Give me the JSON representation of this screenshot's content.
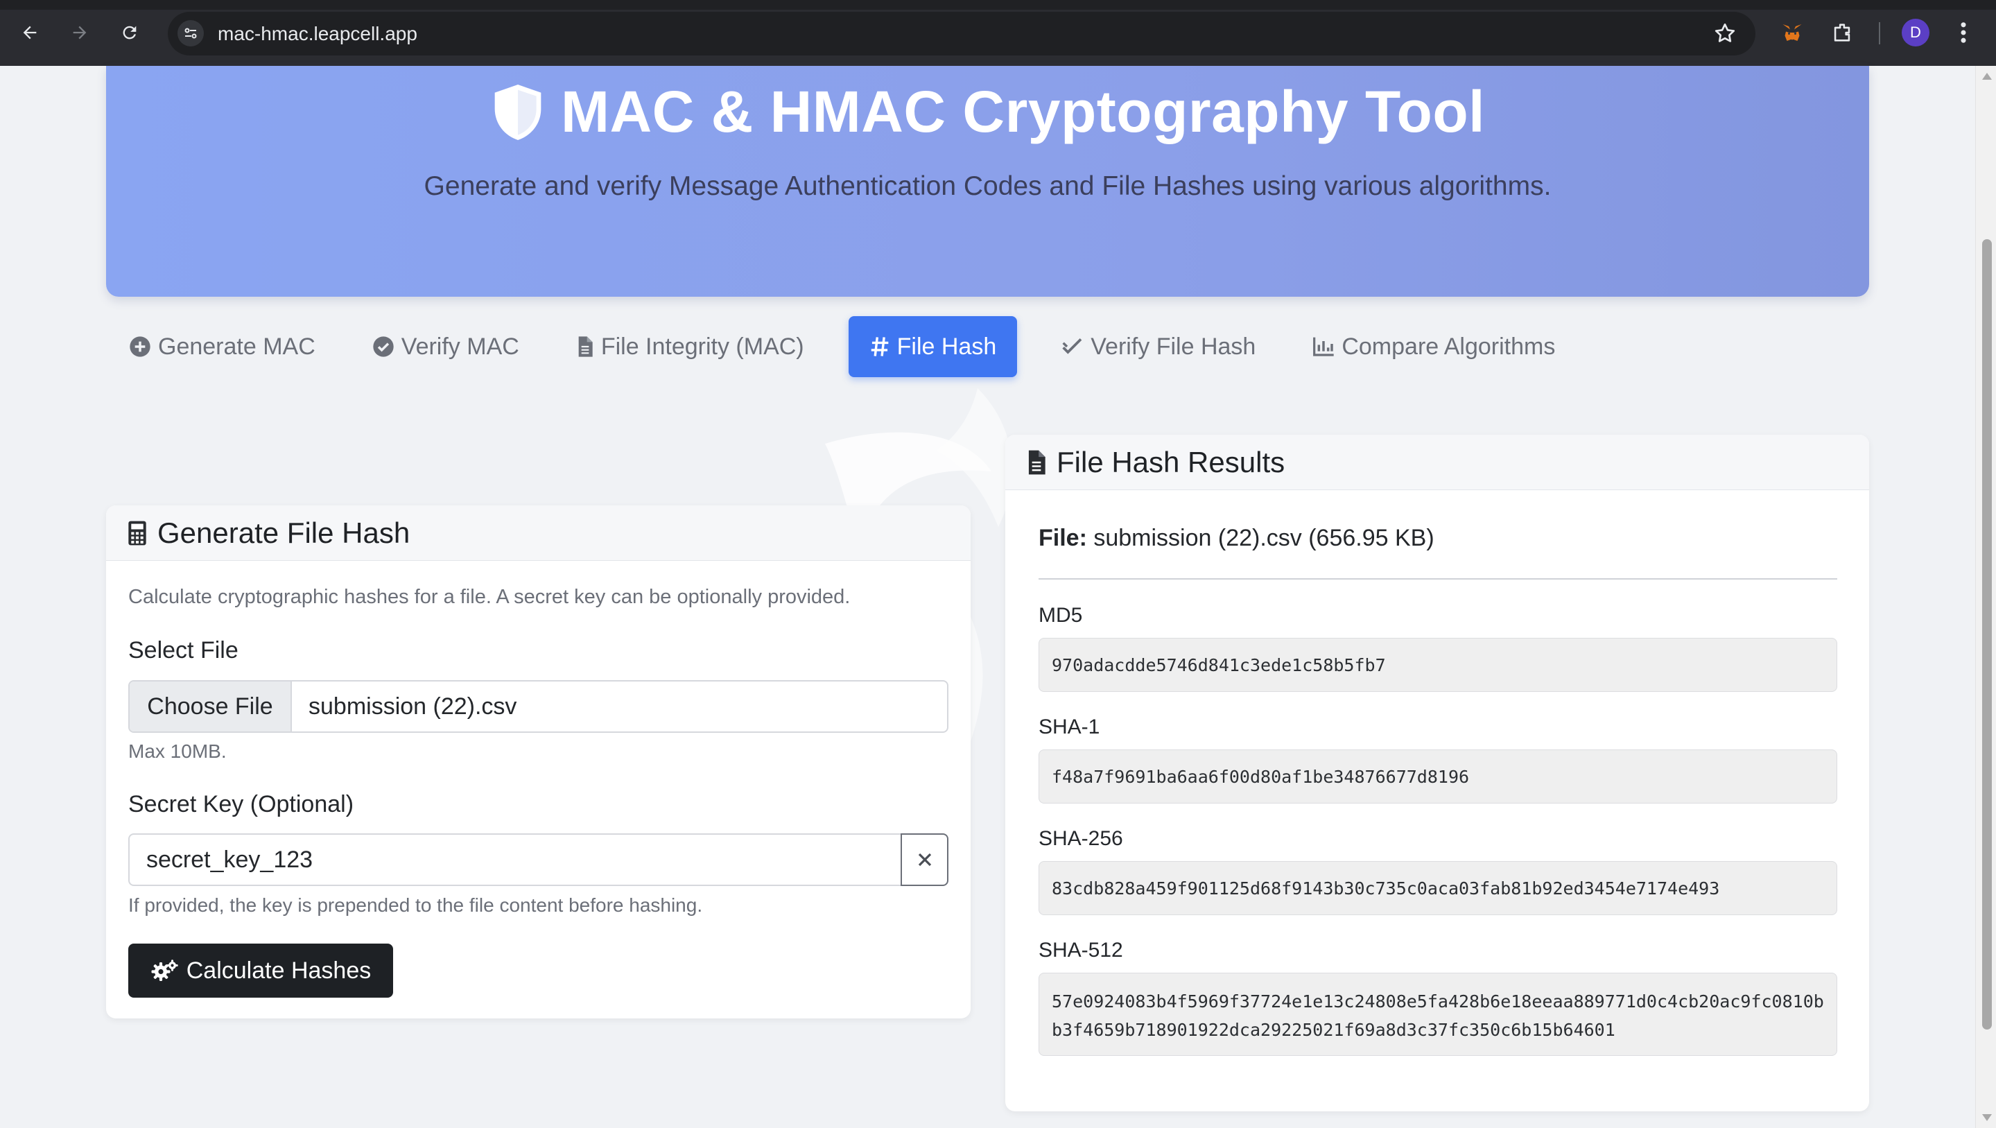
{
  "browser": {
    "url": "mac-hmac.leapcell.app",
    "profile_initial": "D"
  },
  "hero": {
    "title": "MAC & HMAC Cryptography Tool",
    "subtitle": "Generate and verify Message Authentication Codes and File Hashes using various algorithms."
  },
  "tabs": [
    {
      "label": "Generate MAC",
      "icon": "plus-circle-icon",
      "active": false
    },
    {
      "label": "Verify MAC",
      "icon": "check-circle-icon",
      "active": false
    },
    {
      "label": "File Integrity (MAC)",
      "icon": "file-icon",
      "active": false
    },
    {
      "label": "File Hash",
      "icon": "hash-icon",
      "active": true
    },
    {
      "label": "Verify File Hash",
      "icon": "double-check-icon",
      "active": false
    },
    {
      "label": "Compare Algorithms",
      "icon": "bar-chart-icon",
      "active": false
    }
  ],
  "generate": {
    "title": "Generate File Hash",
    "description": "Calculate cryptographic hashes for a file. A secret key can be optionally provided.",
    "file_label": "Select File",
    "choose_button": "Choose File",
    "file_name": "submission (22).csv",
    "file_hint": "Max 10MB.",
    "key_label": "Secret Key (Optional)",
    "key_value": "secret_key_123",
    "key_hint": "If provided, the key is prepended to the file content before hashing.",
    "calculate_button": "Calculate Hashes"
  },
  "results": {
    "title": "File Hash Results",
    "file_prefix": "File:",
    "file_info": "submission (22).csv (656.95 KB)",
    "hashes": [
      {
        "label": "MD5",
        "value": "970adacdde5746d841c3ede1c58b5fb7"
      },
      {
        "label": "SHA-1",
        "value": "f48a7f9691ba6aa6f00d80af1be34876677d8196"
      },
      {
        "label": "SHA-256",
        "value": "83cdb828a459f901125d68f9143b30c735c0aca03fab81b92ed3454e7174e493"
      },
      {
        "label": "SHA-512",
        "value": "57e0924083b4f5969f37724e1e13c24808e5fa428b6e18eeaa889771d0c4cb20ac9fc0810bb3f4659b718901922dca29225021f69a8d3c37fc350c6b15b64601"
      }
    ]
  },
  "colors": {
    "accent": "#3f76f1",
    "hero_gradient_start": "#8aa5f2",
    "hero_gradient_end": "#8396df",
    "dark_button": "#1e2125"
  }
}
